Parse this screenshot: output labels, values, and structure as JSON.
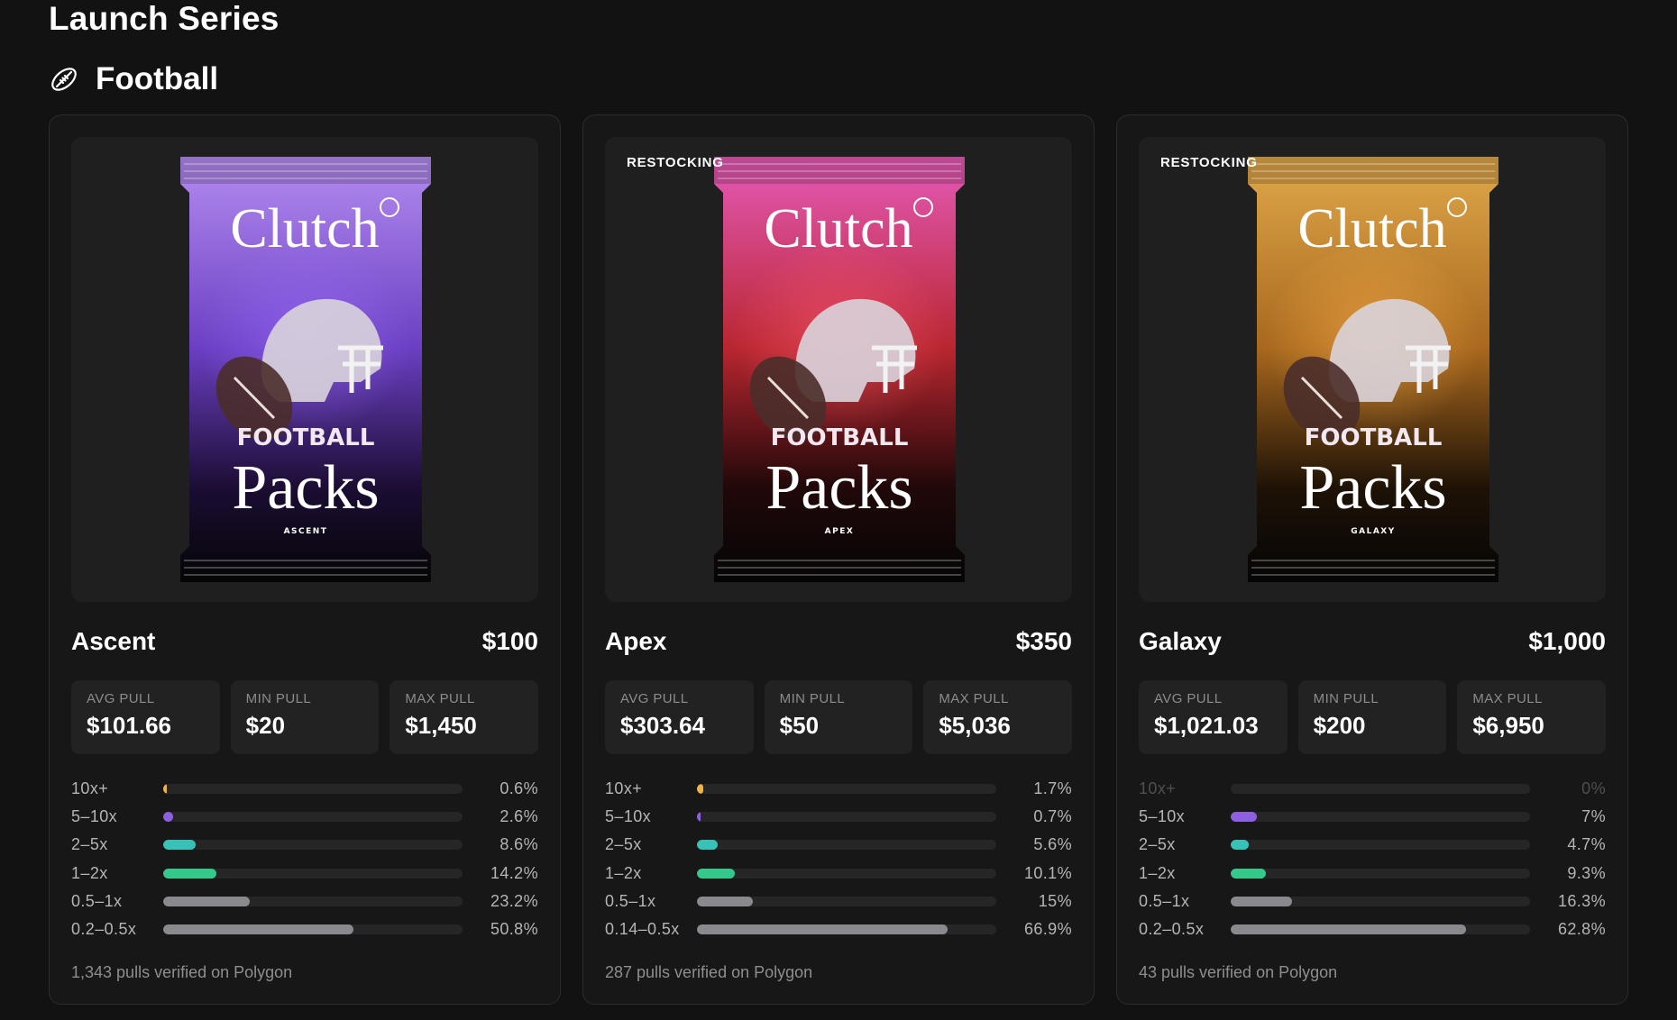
{
  "page": {
    "series_title": "Launch Series",
    "category": {
      "title": "Football",
      "icon": "football-icon"
    }
  },
  "colors": {
    "bar_10x": "#f0b34a",
    "bar_5_10x": "#8e5fe0",
    "bar_2_5x": "#38c1b7",
    "bar_1_2x": "#34c98a",
    "bar_low": "#8a8a8e"
  },
  "cards": [
    {
      "status": "",
      "pack_art": {
        "brand": "Clutch",
        "sport": "FOOTBALL",
        "word": "Packs",
        "tier": "ASCENT",
        "theme": "purple"
      },
      "name": "Ascent",
      "price": "$100",
      "stats": [
        {
          "label": "AVG PULL",
          "value": "$101.66"
        },
        {
          "label": "MIN PULL",
          "value": "$20"
        },
        {
          "label": "MAX PULL",
          "value": "$1,450"
        }
      ],
      "distribution": [
        {
          "label": "10x+",
          "pct": "0.6%",
          "value": 0.6,
          "color": "#f0b34a"
        },
        {
          "label": "5–10x",
          "pct": "2.6%",
          "value": 2.6,
          "color": "#8e5fe0"
        },
        {
          "label": "2–5x",
          "pct": "8.6%",
          "value": 8.6,
          "color": "#38c1b7"
        },
        {
          "label": "1–2x",
          "pct": "14.2%",
          "value": 14.2,
          "color": "#34c98a"
        },
        {
          "label": "0.5–1x",
          "pct": "23.2%",
          "value": 23.2,
          "color": "#8a8a8e"
        },
        {
          "label": "0.2–0.5x",
          "pct": "50.8%",
          "value": 50.8,
          "color": "#8a8a8e"
        }
      ],
      "verified": "1,343 pulls verified on Polygon"
    },
    {
      "status": "RESTOCKING",
      "pack_art": {
        "brand": "Clutch",
        "sport": "FOOTBALL",
        "word": "Packs",
        "tier": "APEX",
        "theme": "red"
      },
      "name": "Apex",
      "price": "$350",
      "stats": [
        {
          "label": "AVG PULL",
          "value": "$303.64"
        },
        {
          "label": "MIN PULL",
          "value": "$50"
        },
        {
          "label": "MAX PULL",
          "value": "$5,036"
        }
      ],
      "distribution": [
        {
          "label": "10x+",
          "pct": "1.7%",
          "value": 1.7,
          "color": "#f0b34a"
        },
        {
          "label": "5–10x",
          "pct": "0.7%",
          "value": 0.7,
          "color": "#8e5fe0"
        },
        {
          "label": "2–5x",
          "pct": "5.6%",
          "value": 5.6,
          "color": "#38c1b7"
        },
        {
          "label": "1–2x",
          "pct": "10.1%",
          "value": 10.1,
          "color": "#34c98a"
        },
        {
          "label": "0.5–1x",
          "pct": "15%",
          "value": 15,
          "color": "#8a8a8e"
        },
        {
          "label": "0.14–0.5x",
          "pct": "66.9%",
          "value": 66.9,
          "color": "#8a8a8e"
        }
      ],
      "verified": "287 pulls verified on Polygon"
    },
    {
      "status": "RESTOCKING",
      "pack_art": {
        "brand": "Clutch",
        "sport": "FOOTBALL",
        "word": "Packs",
        "tier": "GALAXY",
        "theme": "gold"
      },
      "name": "Galaxy",
      "price": "$1,000",
      "stats": [
        {
          "label": "AVG PULL",
          "value": "$1,021.03"
        },
        {
          "label": "MIN PULL",
          "value": "$200"
        },
        {
          "label": "MAX PULL",
          "value": "$6,950"
        }
      ],
      "distribution": [
        {
          "label": "10x+",
          "pct": "0%",
          "value": 0,
          "color": "#f0b34a"
        },
        {
          "label": "5–10x",
          "pct": "7%",
          "value": 7,
          "color": "#8e5fe0"
        },
        {
          "label": "2–5x",
          "pct": "4.7%",
          "value": 4.7,
          "color": "#38c1b7"
        },
        {
          "label": "1–2x",
          "pct": "9.3%",
          "value": 9.3,
          "color": "#34c98a"
        },
        {
          "label": "0.5–1x",
          "pct": "16.3%",
          "value": 16.3,
          "color": "#8a8a8e"
        },
        {
          "label": "0.2–0.5x",
          "pct": "62.8%",
          "value": 62.8,
          "color": "#8a8a8e"
        }
      ],
      "verified": "43 pulls verified on Polygon"
    }
  ]
}
